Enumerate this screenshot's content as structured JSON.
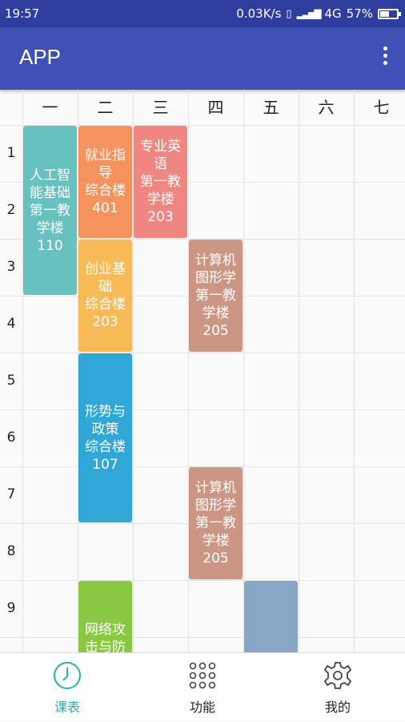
{
  "status_bar": {
    "time": "19:57",
    "network_speed": "0.03K/s",
    "signal_icon": "signal-icon",
    "network_type": "4G",
    "battery_percent": "57%",
    "battery_level": 0.57
  },
  "app_bar": {
    "title": "APP",
    "menu_icon": "more-vert-icon"
  },
  "timetable": {
    "days": [
      "一",
      "二",
      "三",
      "四",
      "五",
      "六",
      "七"
    ],
    "periods": [
      "1",
      "2",
      "3",
      "4",
      "5",
      "6",
      "7",
      "8",
      "9"
    ],
    "courses": [
      {
        "day": 1,
        "start": 1,
        "end": 3,
        "name": "人工智能基础",
        "lines": [
          "人工智",
          "能基础",
          "第一教",
          "学楼110"
        ],
        "color": "#66c1bf"
      },
      {
        "day": 2,
        "start": 1,
        "end": 2,
        "name": "就业指导",
        "lines": [
          "就业指",
          "导",
          "综合楼",
          "401"
        ],
        "color": "#f5935f"
      },
      {
        "day": 3,
        "start": 1,
        "end": 2,
        "name": "专业英语",
        "lines": [
          "专业英",
          "语",
          "第一教",
          "学楼203"
        ],
        "color": "#ef8681"
      },
      {
        "day": 2,
        "start": 3,
        "end": 4,
        "name": "创业基础",
        "lines": [
          "创业基",
          "础",
          "综合楼",
          "203"
        ],
        "color": "#f6bb57"
      },
      {
        "day": 4,
        "start": 3,
        "end": 4,
        "name": "计算机图形学",
        "lines": [
          "计算机",
          "图形学",
          "第一教",
          "学楼205"
        ],
        "color": "#cc9685"
      },
      {
        "day": 2,
        "start": 5,
        "end": 7,
        "name": "形势与政策",
        "lines": [
          "形势与",
          "政策",
          "综合楼",
          "107"
        ],
        "color": "#31a7d8"
      },
      {
        "day": 4,
        "start": 7,
        "end": 8,
        "name": "计算机图形学",
        "lines": [
          "计算机",
          "图形学",
          "第一教",
          "学楼205"
        ],
        "color": "#cc9685"
      },
      {
        "day": 2,
        "start": 9,
        "end": 10,
        "name": "网络攻击与防",
        "lines": [
          "网络攻",
          "击与防"
        ],
        "color": "#88c842"
      },
      {
        "day": 5,
        "start": 9,
        "end": 10,
        "name": "",
        "lines": [],
        "color": "#88a6c6"
      }
    ]
  },
  "bottom_nav": {
    "items": [
      {
        "label": "课表",
        "icon": "clock-icon",
        "active": true,
        "color": "#26b6a6"
      },
      {
        "label": "功能",
        "icon": "grid-dots-icon",
        "active": false,
        "color": "#222222"
      },
      {
        "label": "我的",
        "icon": "gear-icon",
        "active": false,
        "color": "#222222"
      }
    ]
  }
}
